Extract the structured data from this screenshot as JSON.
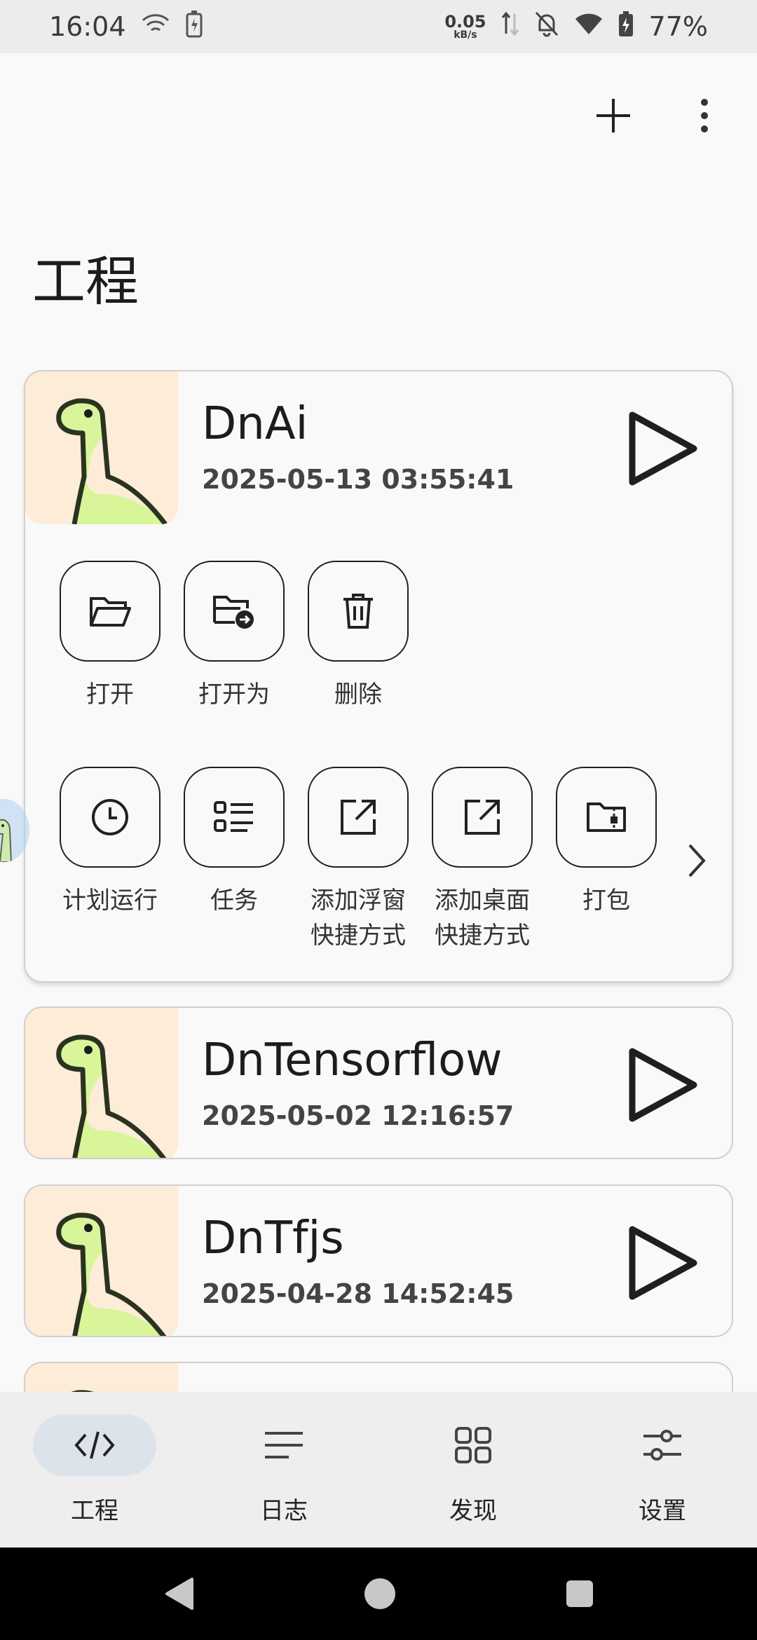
{
  "status_bar": {
    "time": "16:04",
    "net_speed": "0.05",
    "net_unit": "kB/s",
    "battery": "77%"
  },
  "page": {
    "title": "工程"
  },
  "projects": [
    {
      "name": "DnAi",
      "date": "2025-05-13 03:55:41"
    },
    {
      "name": "DnTensorflow",
      "date": "2025-05-02 12:16:57"
    },
    {
      "name": "DnTfjs",
      "date": "2025-04-28 14:52:45"
    }
  ],
  "actions_row1": [
    "打开",
    "打开为",
    "删除"
  ],
  "actions_row2": [
    "计划运行",
    "任务",
    "添加浮窗\n快捷方式",
    "添加桌面\n快捷方式",
    "打包"
  ],
  "bottom_nav": [
    "工程",
    "日志",
    "发现",
    "设置"
  ],
  "colors": {
    "thumb_bg": "#fdecd8",
    "dino": "#d8f59a",
    "active_nav": "#dde3ea"
  }
}
